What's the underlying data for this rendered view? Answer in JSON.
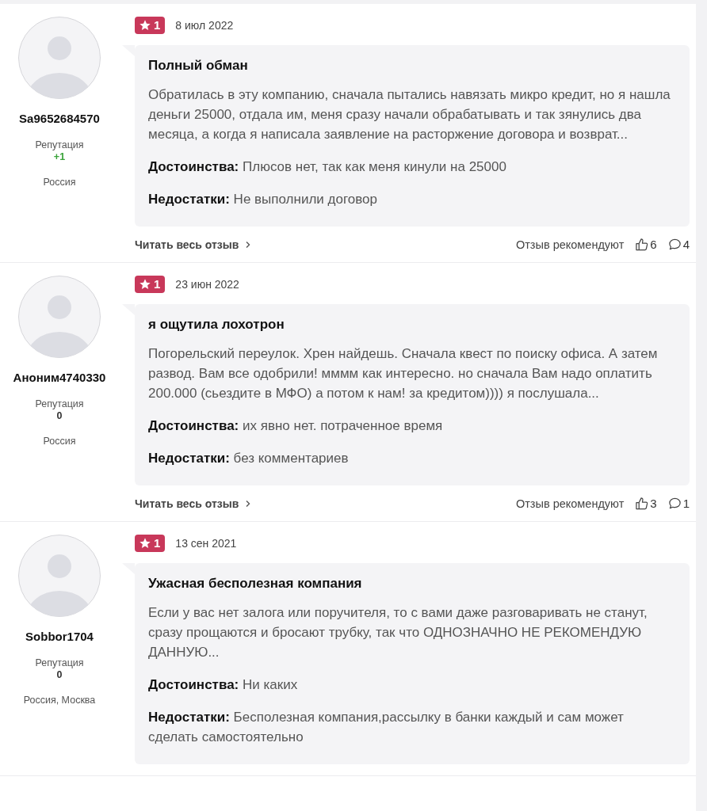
{
  "reviews": [
    {
      "author": "Sa9652684570",
      "reputation_label": "Репутация",
      "reputation": "+1",
      "reputation_positive": true,
      "location": "Россия",
      "rating": "1",
      "date": "8 июл 2022",
      "title": "Полный обман",
      "text": "Обратилась в эту компанию, сначала пытались навязать микро кредит, но я нашла деньги 25000, отдала им, меня сразу начали обрабатывать и так зянулись два месяца, а когда я написала заявление на расторжение договора и возврат...",
      "pros_label": "Достоинства:",
      "pros": "Плюсов нет, так как меня кинули на 25000",
      "cons_label": "Недостатки:",
      "cons": "Не выполнили договор",
      "footer": {
        "read_more": "Читать весь отзыв",
        "recommend_label": "Отзыв рекомендуют",
        "likes": "6",
        "comments": "4"
      }
    },
    {
      "author": "Аноним4740330",
      "reputation_label": "Репутация",
      "reputation": "0",
      "reputation_positive": false,
      "location": "Россия",
      "rating": "1",
      "date": "23 июн 2022",
      "title": "я ощутила лохотрон",
      "text": "Погорельский переулок. Хрен найдешь. Сначала квест по поиску офиса. А затем развод. Вам все одобрили! мммм как интересно. но сначала Вам надо оплатить 200.000 (сьездите в МФО) а потом к нам! за кредитом)))) я послушала...",
      "pros_label": "Достоинства:",
      "pros": "их явно нет. потраченное время",
      "cons_label": "Недостатки:",
      "cons": "без комментариев",
      "footer": {
        "read_more": "Читать весь отзыв",
        "recommend_label": "Отзыв рекомендуют",
        "likes": "3",
        "comments": "1"
      }
    },
    {
      "author": "Sobbor1704",
      "reputation_label": "Репутация",
      "reputation": "0",
      "reputation_positive": false,
      "location": "Россия, Москва",
      "rating": "1",
      "date": "13 сен 2021",
      "title": "Ужасная бесполезная компания",
      "text": "Если у вас нет залога или поручителя, то с вами даже разговаривать не станут, сразу прощаются и бросают трубку, так что ОДНОЗНАЧНО НЕ РЕКОМЕНДУЮ ДАННУЮ...",
      "pros_label": "Достоинства:",
      "pros": "Ни каких",
      "cons_label": "Недостатки:",
      "cons": "Бесполезная компания,рассылку в банки каждый и сам может сделать самостоятельно"
    }
  ]
}
